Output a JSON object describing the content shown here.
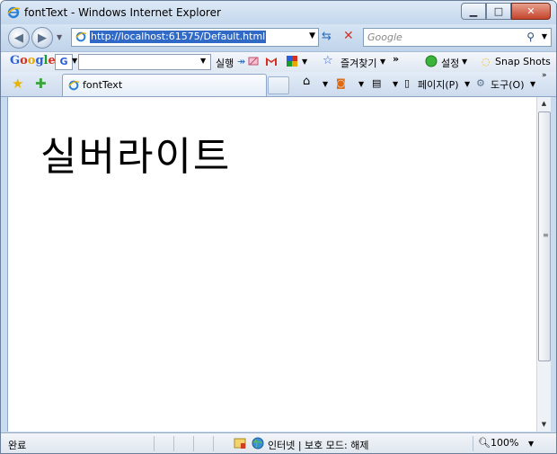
{
  "window": {
    "title": "fontText - Windows Internet Explorer"
  },
  "address": {
    "url": "http://localhost:61575/Default.html"
  },
  "search": {
    "placeholder": "Google"
  },
  "google_toolbar": {
    "logo": "Google",
    "run_label": "실행",
    "favorites_label": "즐겨찾기",
    "more": "»",
    "settings_label": "설정",
    "snapshots_label": "Snap Shots"
  },
  "tabs": [
    {
      "label": "fontText"
    }
  ],
  "command_bar": {
    "more": "»",
    "page_label": "페이지(P)",
    "tools_label": "도구(O)"
  },
  "content": {
    "text": "실버라이트"
  },
  "status": {
    "left": "완료",
    "zone": "인터넷 | 보호 모드: 해제",
    "zoom": "100%"
  }
}
